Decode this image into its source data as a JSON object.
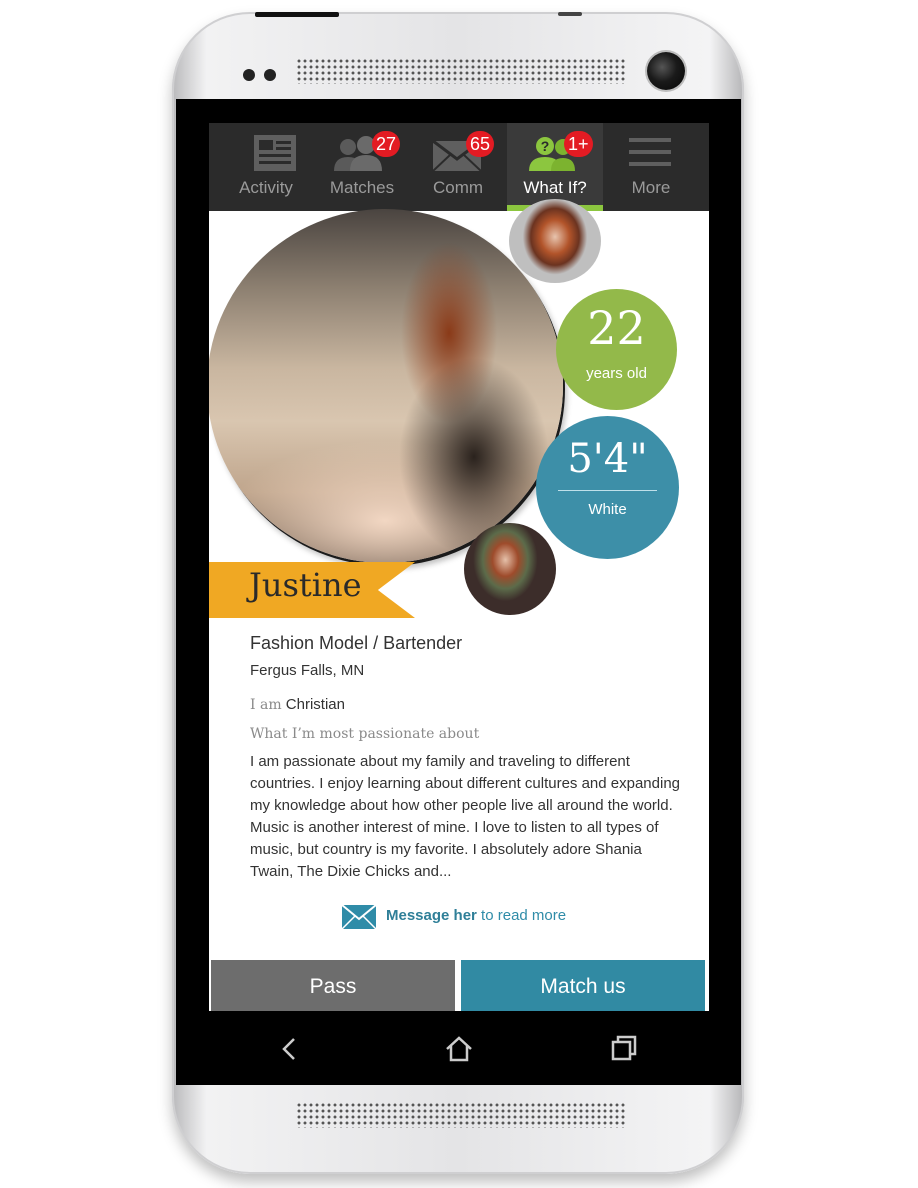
{
  "tabs": [
    {
      "label": "Activity",
      "icon": "newspaper-icon",
      "badge": null,
      "active": false
    },
    {
      "label": "Matches",
      "icon": "people-icon",
      "badge": "27",
      "active": false
    },
    {
      "label": "Comm",
      "icon": "envelope-icon",
      "badge": "65",
      "active": false
    },
    {
      "label": "What If?",
      "icon": "question-people-icon",
      "badge": "1+",
      "active": true
    },
    {
      "label": "More",
      "icon": "menu-icon",
      "badge": null,
      "active": false
    }
  ],
  "profile": {
    "name": "Justine",
    "age": "22",
    "age_unit": "years old",
    "height": "5'4\"",
    "ethnicity": "White",
    "occupation": "Fashion Model / Bartender",
    "location": "Fergus Falls, MN",
    "faith_prefix": "I am",
    "faith": "Christian",
    "passion_heading": "What I’m most passionate about",
    "bio": "I am passionate about my family and traveling to different countries. I enjoy learning about different cultures and expanding my knowledge about how other people live all around the world. Music is another interest of mine. I love to listen to all types of music, but country is my favorite. I absolutely adore Shania Twain, The Dixie Chicks and..."
  },
  "message": {
    "strong": "Message her",
    "rest": " to read more"
  },
  "actions": {
    "pass": "Pass",
    "match": "Match us"
  },
  "colors": {
    "accent_green": "#8cc63f",
    "age_green": "#93b94a",
    "height_teal": "#3d8fa8",
    "ribbon_orange": "#f0a823",
    "match_blue": "#318aa3",
    "pass_gray": "#6d6d6d",
    "badge_red": "#e31b23"
  }
}
